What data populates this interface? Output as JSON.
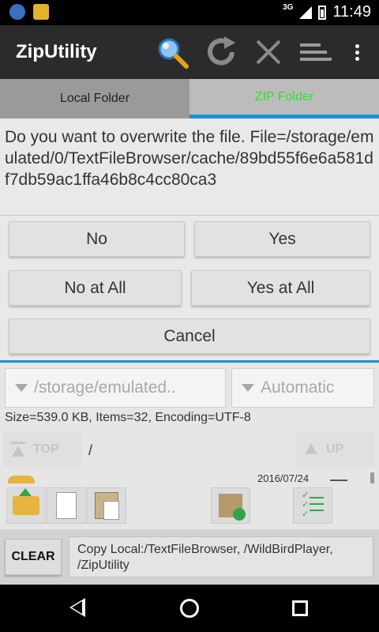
{
  "status": {
    "network": "3G",
    "time": "11:49"
  },
  "app": {
    "title": "ZipUtility"
  },
  "actions": {
    "search": "search-icon",
    "refresh": "refresh-icon",
    "close": "close-icon",
    "sort": "sort-icon",
    "more": "more-vert-icon"
  },
  "tabs": [
    {
      "label": "Local Folder"
    },
    {
      "label": "ZIP Folder"
    }
  ],
  "dialog": {
    "message": "Do you want to overwrite the file. File=/storage/emulated/0/TextFileBrowser/cache/89bd55f6e6a581df7db59ac1ffa46b8c4cc80ca3",
    "buttons": {
      "no": "No",
      "yes": "Yes",
      "no_all": "No at All",
      "yes_all": "Yes at All",
      "cancel": "Cancel"
    }
  },
  "browser": {
    "path_spinner": "/storage/emulated..",
    "encoding_spinner": "Automatic",
    "info": "Size=539.0 KB, Items=32, Encoding=UTF-8",
    "top_label": "TOP",
    "up_label": "UP",
    "current_path": "/",
    "first_row_date": "2016/07/24"
  },
  "bottom": {
    "clear_label": "CLEAR",
    "clipboard_text": "Copy Local:/TextFileBrowser, /WildBirdPlayer, /ZipUtility"
  },
  "colors": {
    "accent": "#1d8fd8",
    "zip_tab_text": "#2ee02e",
    "action_bar": "#2b2b2b"
  }
}
